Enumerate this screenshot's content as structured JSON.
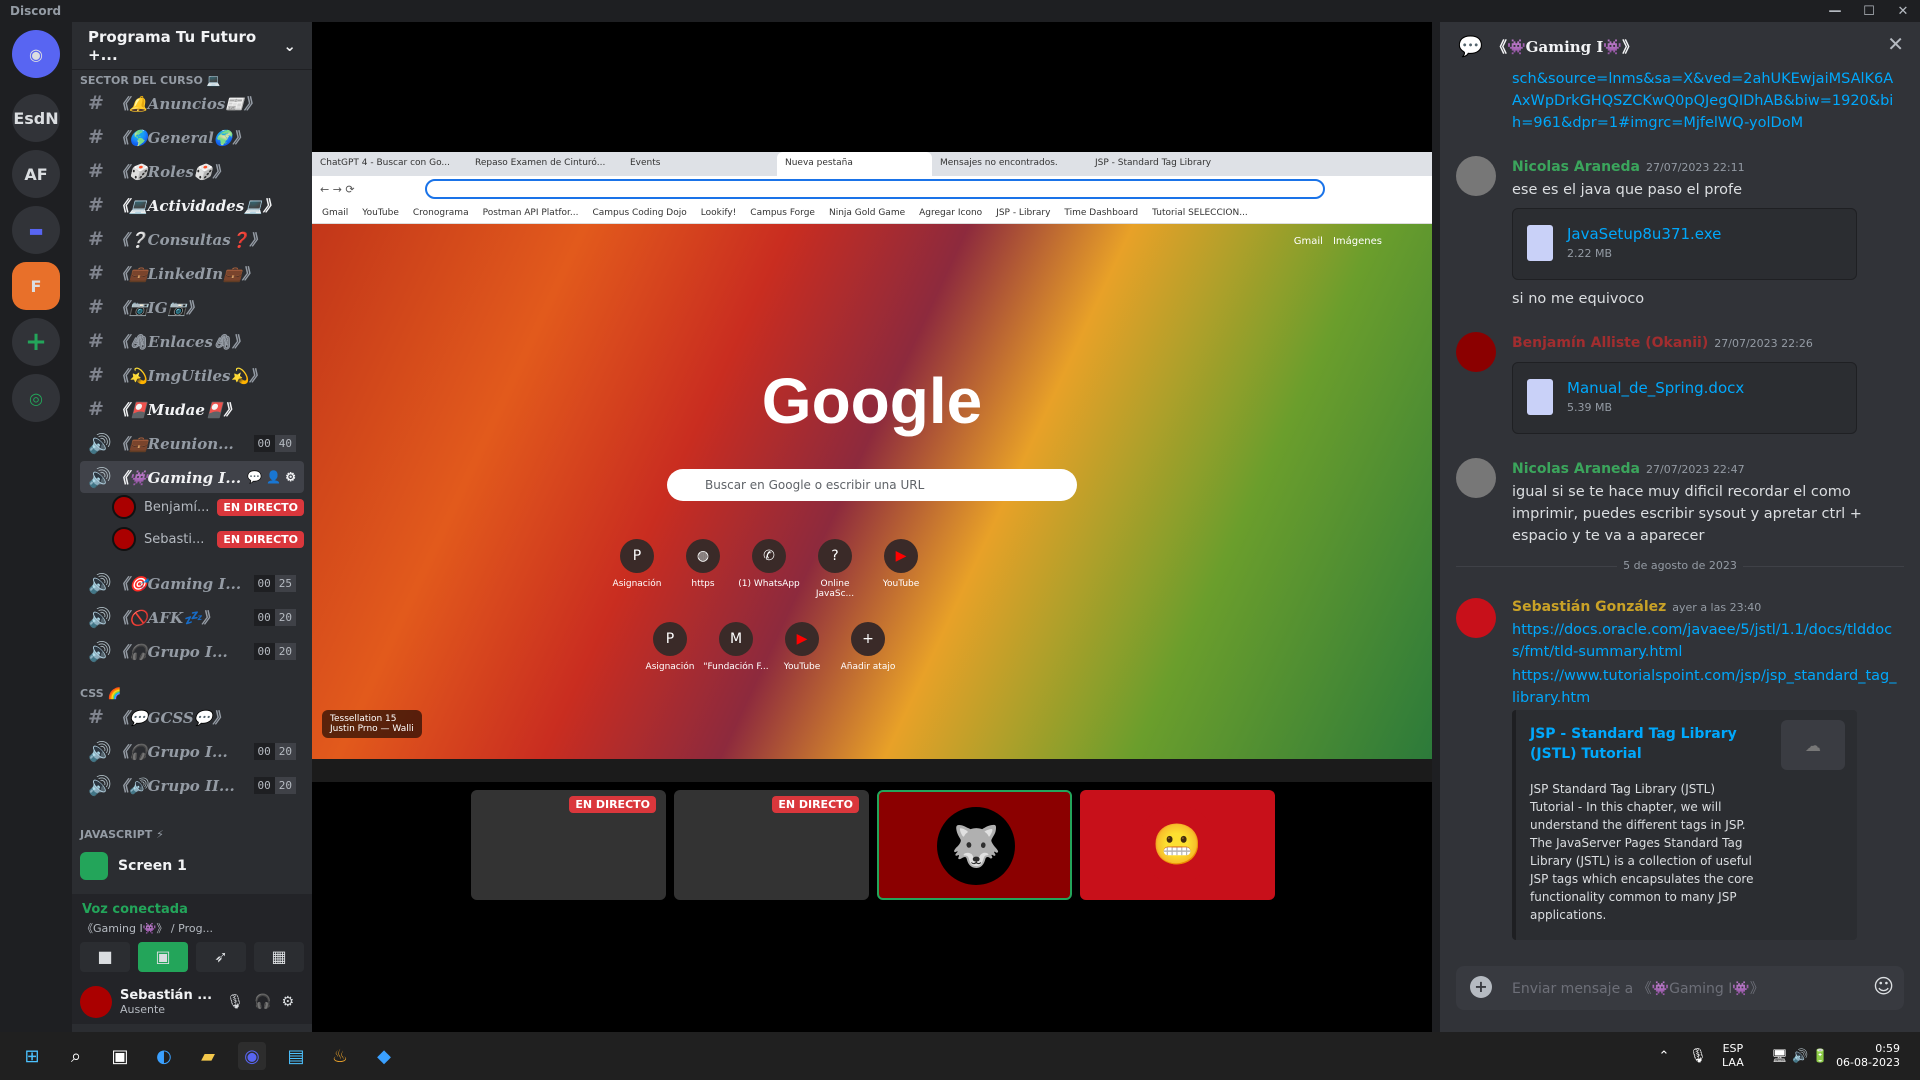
{
  "app": {
    "title": "Discord"
  },
  "guilds": [
    {
      "label": "EsdN"
    },
    {
      "label": "AF"
    }
  ],
  "server": {
    "name": "Programa Tu Futuro +..."
  },
  "categories": {
    "sector": "SECTOR DEL CURSO 💻",
    "css": "CSS 🌈",
    "js": "JAVASCRIPT ⚡"
  },
  "channels": [
    {
      "icon": "#",
      "label": "《🔔Anuncios📰》"
    },
    {
      "icon": "#",
      "label": "《🌎General🌍》"
    },
    {
      "icon": "#",
      "label": "《🎲Roles🎲》"
    },
    {
      "icon": "#",
      "label": "《💻Actividades💻》"
    },
    {
      "icon": "#",
      "label": "《❔Consultas❓》"
    },
    {
      "icon": "#",
      "label": "《💼LinkedIn💼》"
    },
    {
      "icon": "#",
      "label": "《📷IG📷》"
    },
    {
      "icon": "#",
      "label": "《🖇Enlaces🖇》"
    },
    {
      "icon": "#",
      "label": "《💫ImgUtiles💫》"
    },
    {
      "icon": "#",
      "label": "《🎴Mudae🎴》"
    },
    {
      "icon": "🔊",
      "label": "《💼Reunion...",
      "c1": "00",
      "c2": "40"
    },
    {
      "icon": "🔊",
      "label": "《👾Gaming I..."
    },
    {
      "icon": "🔊",
      "label": "《🎯Gaming I...",
      "c1": "00",
      "c2": "25"
    },
    {
      "icon": "🔊",
      "label": "《🚫AFK💤》",
      "c1": "00",
      "c2": "20"
    },
    {
      "icon": "🔊",
      "label": "《🎧Grupo I...",
      "c1": "00",
      "c2": "20"
    },
    {
      "icon": "#",
      "label": "《💬GCSS💬》"
    },
    {
      "icon": "🔊",
      "label": "《🎧Grupo I...",
      "c1": "00",
      "c2": "20"
    },
    {
      "icon": "🔊",
      "label": "《🔊Grupo II...",
      "c1": "00",
      "c2": "20"
    }
  ],
  "voice_users": [
    {
      "name": "Benjamí...",
      "badge": "EN DIRECTO"
    },
    {
      "name": "Sebasti...",
      "badge": "EN DIRECTO"
    }
  ],
  "screen": {
    "label": "Screen 1"
  },
  "voice": {
    "status": "Voz conectada",
    "channel": "《Gaming I👾》 / Prog..."
  },
  "user": {
    "name": "Sebastián ...",
    "status": "Ausente"
  },
  "browser": {
    "tabs": [
      "ChatGPT 4 - Buscar con Go...",
      "Repaso Examen de Cinturó...",
      "Events",
      "Nueva pestaña",
      "Mensajes no encontrados.",
      "JSP - Standard Tag Library"
    ],
    "bookmarks": [
      "Gmail",
      "YouTube",
      "Cronograma",
      "Postman API Platfor...",
      "Campus Coding Dojo",
      "Lookify!",
      "Campus Forge",
      "Ninja Gold Game",
      "Agregar Icono",
      "JSP - Library",
      "Time Dashboard",
      "Tutorial SELECCION..."
    ],
    "links": [
      "Gmail",
      "Imágenes"
    ],
    "logo": "Google",
    "search_placeholder": "Buscar en Google o escribir una URL",
    "shortcuts": [
      "Asignación",
      "https",
      "(1) WhatsApp",
      "Online JavaSc...",
      "YouTube",
      "Asignación",
      "\"Fundación F...",
      "YouTube",
      "Añadir atajo"
    ],
    "credit": "Tessellation 15",
    "credit_author": "Justin Prno — Walli"
  },
  "thumb_badges": [
    "EN DIRECTO",
    "EN DIRECTO"
  ],
  "chat": {
    "title": "《👾Gaming I👾》",
    "top_link": "sch&source=lnms&sa=X&ved=2ahUKEwjaiMSAlK6AAxWpDrkGHQSZCKwQ0pQJegQIDhAB&biw=1920&bih=961&dpr=1#imgrc=MjfelWQ-yolDoM",
    "messages": [
      {
        "author": "Nicolas Araneda",
        "time": "27/07/2023 22:11",
        "text": "ese es el java que paso el profe",
        "file": "JavaSetup8u371.exe",
        "size": "2.22 MB",
        "after": "si no me equivoco"
      },
      {
        "author": "Benjamín Alliste (Okanii)",
        "time": "27/07/2023 22:26",
        "file": "Manual_de_Spring.docx",
        "size": "5.39 MB"
      },
      {
        "author": "Nicolas Araneda",
        "time": "27/07/2023 22:47",
        "text": "igual si se te hace muy dificil recordar el como imprimir, puedes escribir sysout y apretar ctrl + espacio y te va a aparecer"
      },
      {
        "author": "Sebastián González",
        "time": "ayer a las 23:40",
        "link1": "https://docs.oracle.com/javaee/5/jstl/1.1/docs/tlddocs/fmt/tld-summary.html",
        "link2": "https://www.tutorialspoint.com/jsp/jsp_standard_tag_library.htm"
      }
    ],
    "divider": "5 de agosto de 2023",
    "embed_title": "JSP - Standard Tag Library (JSTL) Tutorial",
    "embed_text": "JSP Standard Tag Library (JSTL) Tutorial - In this chapter, we will understand the different tags in JSP. The JavaServer Pages Standard Tag Library (JSTL) is a collection of useful JSP tags which encapsulates the core functionality common to many JSP applications.",
    "composer_placeholder": "Enviar mensaje a 《👾Gaming I👾》"
  },
  "tray": {
    "lang": "ESP",
    "lang2": "LAA",
    "time": "0:59",
    "date": "06-08-2023"
  },
  "colors": {
    "accent": "#5865f2",
    "live": "#da373c",
    "green": "#23a55a",
    "link": "#00a8fc"
  }
}
